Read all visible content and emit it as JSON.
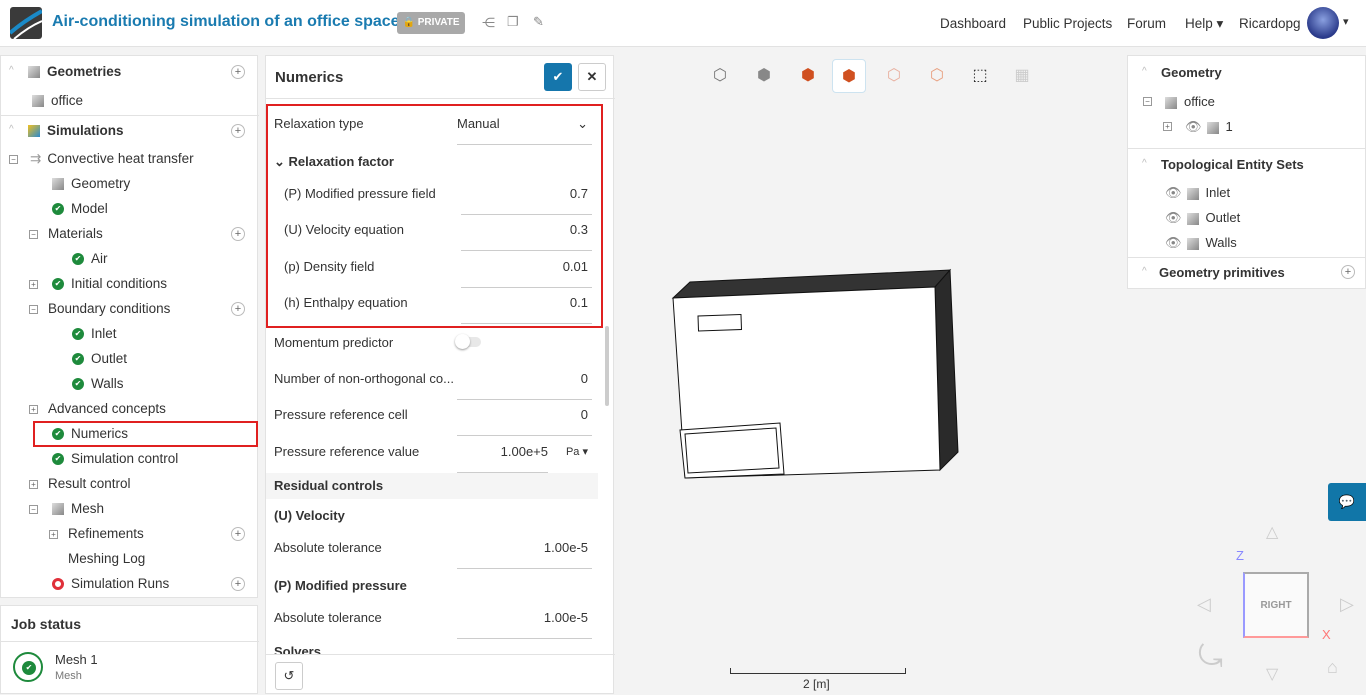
{
  "header": {
    "title": "Air-conditioning simulation of an office space",
    "badge": "PRIVATE",
    "nav": [
      "Dashboard",
      "Public Projects",
      "Forum",
      "Help",
      "Ricardopg"
    ]
  },
  "tree": {
    "geometries": "Geometries",
    "office": "office",
    "simulations": "Simulations",
    "convective": "Convective heat transfer",
    "geometry": "Geometry",
    "model": "Model",
    "materials": "Materials",
    "air": "Air",
    "initial": "Initial conditions",
    "boundary": "Boundary conditions",
    "inlet": "Inlet",
    "outlet": "Outlet",
    "walls": "Walls",
    "advanced": "Advanced concepts",
    "numerics": "Numerics",
    "simcontrol": "Simulation control",
    "result": "Result control",
    "mesh": "Mesh",
    "refinements": "Refinements",
    "meshlog": "Meshing Log",
    "runs": "Simulation Runs"
  },
  "job": {
    "title": "Job status",
    "name": "Mesh 1",
    "type": "Mesh"
  },
  "numerics": {
    "title": "Numerics",
    "relaxation_type_label": "Relaxation type",
    "relaxation_type": "Manual",
    "relaxation_factor": "Relaxation factor",
    "fields": [
      {
        "label": "(P) Modified pressure field",
        "value": "0.7"
      },
      {
        "label": "(U) Velocity equation",
        "value": "0.3"
      },
      {
        "label": "(p) Density field",
        "value": "0.01"
      },
      {
        "label": "(h) Enthalpy equation",
        "value": "0.1"
      }
    ],
    "momentum": "Momentum predictor",
    "momentum_on": false,
    "nonortho_label": "Number of non-orthogonal co...",
    "nonortho": "0",
    "refcell_label": "Pressure reference cell",
    "refcell": "0",
    "refval_label": "Pressure reference value",
    "refval": "1.00e+5",
    "refval_unit": "Pa",
    "residual": "Residual controls",
    "u_velocity": "(U) Velocity",
    "abs_tol": "Absolute tolerance",
    "u_tol": "1.00e-5",
    "p_pressure": "(P) Modified pressure",
    "p_tol": "1.00e-5",
    "solvers": "Solvers"
  },
  "right": {
    "geometry": "Geometry",
    "office": "office",
    "part": "1",
    "topo": "Topological Entity Sets",
    "sets": [
      "Inlet",
      "Outlet",
      "Walls"
    ],
    "primitives": "Geometry primitives"
  },
  "viewport": {
    "scale": "2 [m]",
    "cube_face": "RIGHT",
    "axis_z": "Z",
    "axis_x": "X"
  }
}
